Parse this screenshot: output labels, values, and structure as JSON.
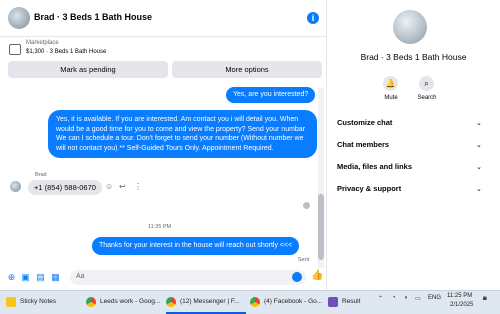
{
  "header": {
    "title": "Brad · 3 Beds 1 Bath House",
    "info_icon": "info-icon"
  },
  "marketplace": {
    "label": "Marketplace",
    "listing": "$1,300 · 3 Beds 1 Bath House"
  },
  "actions": {
    "pending": "Mark as pending",
    "more": "More options"
  },
  "messages": {
    "out1": "Yes, are you interested?",
    "out2": "Yes, it is available. If you are interested. Am contact you i will detail you. When would be a good time for you to come and view the property? Send your numbar We can I schedule a tour. Don't forget to send your number (Without number we will not contact you).** Self-Guided Tours Only. Appointment Required.",
    "sender": "Brad",
    "in1": "+1 (854) 588-0670",
    "timestamp": "11:25 PM",
    "out3": "Thanks for your interest in the house will reach out shortly <<<",
    "status": "Sent"
  },
  "composer": {
    "placeholder": "Aa"
  },
  "sidebar": {
    "name": "Brad · 3 Beds 1 Bath House",
    "mute": "Mute",
    "search": "Search",
    "rows": [
      "Customize chat",
      "Chat members",
      "Media, files and links",
      "Privacy & support"
    ]
  },
  "taskbar": {
    "items": [
      "Sticky Notes",
      "Leeds work - Goog...",
      "(12) Messenger | F...",
      "(4) Facebook - Go..."
    ],
    "result": "Result",
    "lang": "ENG",
    "time": "11:25 PM",
    "date": "2/1/2025"
  },
  "colors": {
    "accent": "#0a7cff",
    "bubble_in": "#e4e6eb"
  }
}
